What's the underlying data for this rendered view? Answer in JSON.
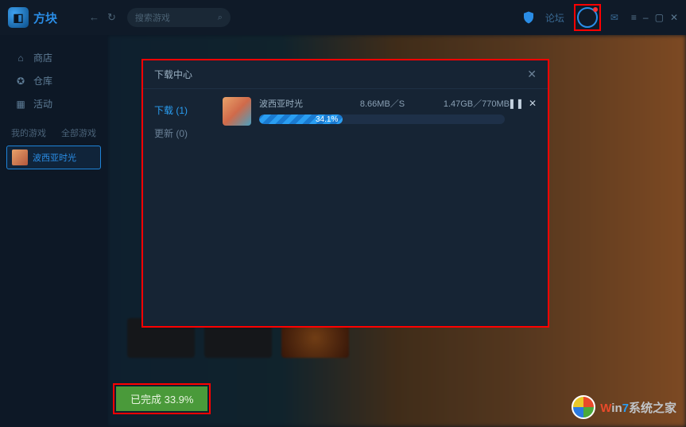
{
  "app": {
    "name": "方块"
  },
  "search": {
    "placeholder": "搜索游戏"
  },
  "top": {
    "link1": "论坛"
  },
  "sidebar": {
    "items": [
      {
        "label": "商店"
      },
      {
        "label": "仓库"
      },
      {
        "label": "活动"
      }
    ],
    "section1": "我的游戏",
    "section2": "全部游戏",
    "game": "波西亚时光"
  },
  "modal": {
    "title": "下载中心",
    "tabs": {
      "download": "下载 (1)",
      "update": "更新 (0)"
    },
    "item": {
      "name": "波西亚时光",
      "speed": "8.66MB／S",
      "size": "1.47GB／770MB",
      "percent": "34.1%",
      "percent_value": 34.1
    }
  },
  "status": {
    "text": "已完成 33.9%"
  },
  "watermark": {
    "brand_w": "W",
    "brand_in": "in",
    "brand_7": "7",
    "rest": "系统之家"
  }
}
